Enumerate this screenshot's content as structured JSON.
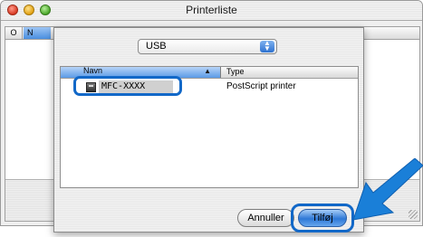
{
  "window": {
    "title": "Printerliste"
  },
  "background_table": {
    "col_a": "O",
    "col_b": "N"
  },
  "sheet": {
    "connection_popup": {
      "selected": "USB"
    },
    "list": {
      "columns": [
        "Navn",
        "Type"
      ],
      "rows": [
        {
          "name": "MFC-XXXX",
          "type": "PostScript printer"
        }
      ]
    },
    "buttons": {
      "cancel": "Annuller",
      "add": "Tilføj"
    }
  },
  "colors": {
    "highlight": "#1268c8",
    "arrow": "#1a7fd8",
    "default_button": "#2e78d6"
  },
  "icons": [
    "close-icon",
    "minimize-icon",
    "zoom-icon",
    "popup-arrows-icon",
    "sort-arrow-icon",
    "printer-icon",
    "callout-arrow-icon",
    "resize-grip-icon"
  ]
}
